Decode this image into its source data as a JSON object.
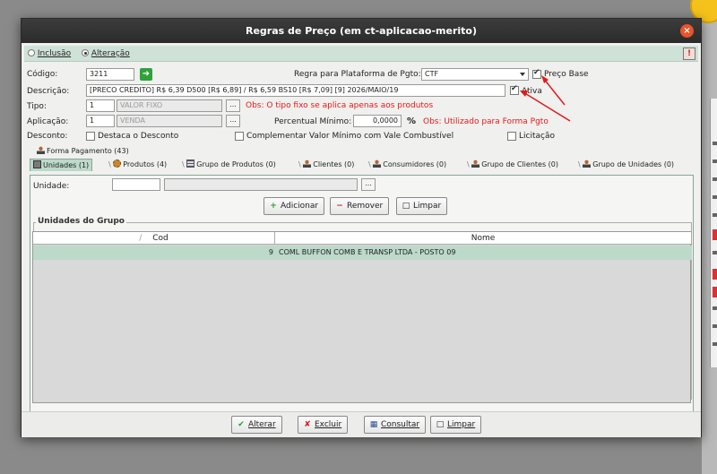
{
  "window": {
    "title": "Regras de Preço (em ct-aplicacao-merito)",
    "close_glyph": "×",
    "info_glyph": "!"
  },
  "mode": {
    "inclusao": "Inclusão",
    "alteracao": "Alteração",
    "selected": "Alteração"
  },
  "form": {
    "codigo_label": "Código:",
    "codigo_value": "3211",
    "go_glyph": "➜",
    "regra_label": "Regra para Plataforma de Pgto:",
    "regra_value": "CTF",
    "preco_base_label": "Preço Base",
    "preco_base_checked": true,
    "descricao_label": "Descrição:",
    "descricao_value": "[PRECO CREDITO] R$ 6,39 D500 [R$ 6,89] / R$ 6,59 BS10 [R$ 7,09] [9] 2026/MAIO/19",
    "ativa_label": "Ativa",
    "ativa_checked": true,
    "tipo_label": "Tipo:",
    "tipo_code": "1",
    "tipo_value": "VALOR FIXO",
    "tipo_obs": "Obs: O tipo fixo se aplica apenas aos produtos",
    "aplicacao_label": "Aplicação:",
    "aplicacao_code": "1",
    "aplicacao_value": "VENDA",
    "percentual_label": "Percentual Mínimo:",
    "percentual_value": "0,0000",
    "percent_sign": "%",
    "percentual_obs": "Obs: Utilizado para Forma Pgto",
    "desconto_label": "Desconto:",
    "destaca_label": "Destaca o Desconto",
    "complementar_label": "Complementar Valor Mínimo com Vale Combustível",
    "licitacao_label": "Licitação",
    "dots": "..."
  },
  "tabs": {
    "forma_pagamento": "Forma Pagamento (43)",
    "unidades": "Unidades (1)",
    "produtos": "Produtos (4)",
    "grupo_produtos": "Grupo de Produtos (0)",
    "clientes": "Clientes (0)",
    "consumidores": "Consumidores (0)",
    "grupo_clientes": "Grupo de Clientes (0)",
    "grupo_unidades": "Grupo de Unidades (0)",
    "sep": "\\"
  },
  "unidades_tab": {
    "unidade_label": "Unidade:",
    "adicionar": "Adicionar",
    "remover": "Remover",
    "limpar": "Limpar",
    "group_title": "Unidades do Grupo",
    "columns": {
      "cod": "Cod",
      "nome": "Nome",
      "sort_glyph": "/"
    },
    "rows": [
      {
        "cod": "9",
        "nome": "COML BUFFON COMB E TRANSP LTDA - POSTO 09"
      }
    ]
  },
  "footer": {
    "alterar": "Alterar",
    "excluir": "Excluir",
    "consultar": "Consultar",
    "limpar": "Limpar"
  },
  "colors": {
    "accent": "#bcd9ca",
    "obs_red": "#e01b1b",
    "title_bg": "#2b2b2b",
    "close": "#e9542a"
  }
}
